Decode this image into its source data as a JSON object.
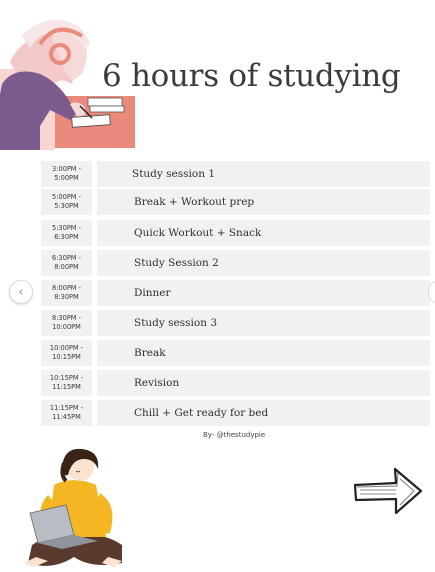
{
  "title": "6 hours of studying",
  "schedule": [
    {
      "time": "3:00PM -\n5:00PM",
      "activity": "Study session 1"
    },
    {
      "time": "5:00PM -\n5:30PM",
      "activity": "Break + Workout prep"
    },
    {
      "time": "5:30PM -\n6:30PM",
      "activity": "Quick Workout + Snack"
    },
    {
      "time": "6:30PM -\n8:00PM",
      "activity": "Study Session 2"
    },
    {
      "time": "8:00PM -\n8:30PM",
      "activity": "Dinner"
    },
    {
      "time": "8:30PM -\n10:00PM",
      "activity": "Study session 3"
    },
    {
      "time": "10:00PM -\n10:15PM",
      "activity": "Break"
    },
    {
      "time": "10:15PM -\n11:15PM",
      "activity": "Revision"
    },
    {
      "time": "11:15PM -\n11:45PM",
      "activity": "Chill + Get ready for bed"
    }
  ],
  "credit": "By- @thestudypie",
  "icons": {
    "prev": "chevron-left-icon",
    "next_arrow": "arrow-right-icon"
  },
  "colors": {
    "row_bg": "#f1f1f1",
    "sweater": "#f5b623",
    "hoodie": "#7b5a8e",
    "desk": "#e98a7c"
  }
}
